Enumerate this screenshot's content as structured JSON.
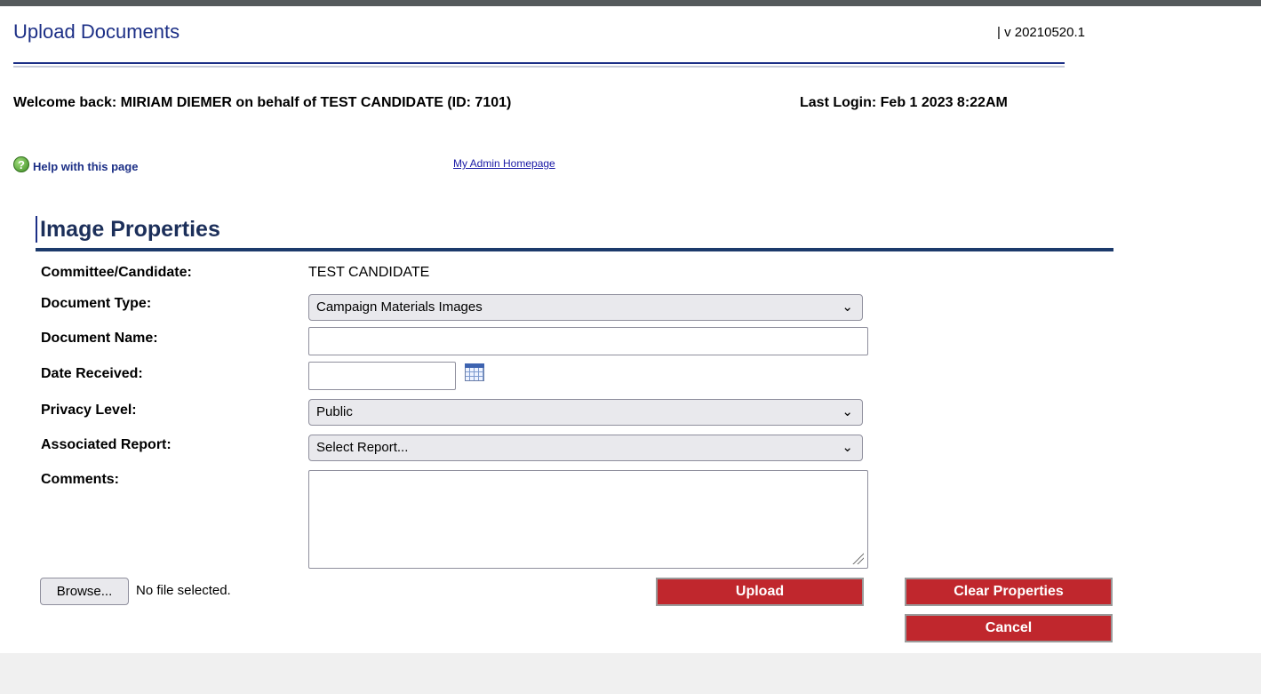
{
  "header": {
    "title": "Upload Documents",
    "version": "| v 20210520.1",
    "welcome": "Welcome back: MIRIAM DIEMER on behalf of TEST CANDIDATE (ID: 7101)",
    "last_login": "Last Login: Feb 1 2023 8:22AM"
  },
  "nav": {
    "help_icon_glyph": "?",
    "help_label": "Help with this page",
    "admin_link": "My Admin Homepage"
  },
  "section": {
    "title": "Image Properties"
  },
  "form": {
    "committee_label": "Committee/Candidate:",
    "committee_value": "TEST CANDIDATE",
    "doc_type_label": "Document Type:",
    "doc_type_value": "Campaign Materials Images",
    "doc_name_label": "Document Name:",
    "doc_name_value": "",
    "date_label": "Date Received:",
    "date_value": "",
    "privacy_label": "Privacy Level:",
    "privacy_value": "Public",
    "report_label": "Associated Report:",
    "report_value": "Select Report...",
    "comments_label": "Comments:",
    "comments_value": ""
  },
  "file": {
    "browse_label": "Browse...",
    "status": "No file selected."
  },
  "buttons": {
    "upload": "Upload",
    "clear": "Clear Properties",
    "cancel": "Cancel"
  },
  "icons": {
    "chevron": "⌄"
  },
  "colors": {
    "title_blue": "#1c2f86",
    "button_red": "#c0272d"
  }
}
